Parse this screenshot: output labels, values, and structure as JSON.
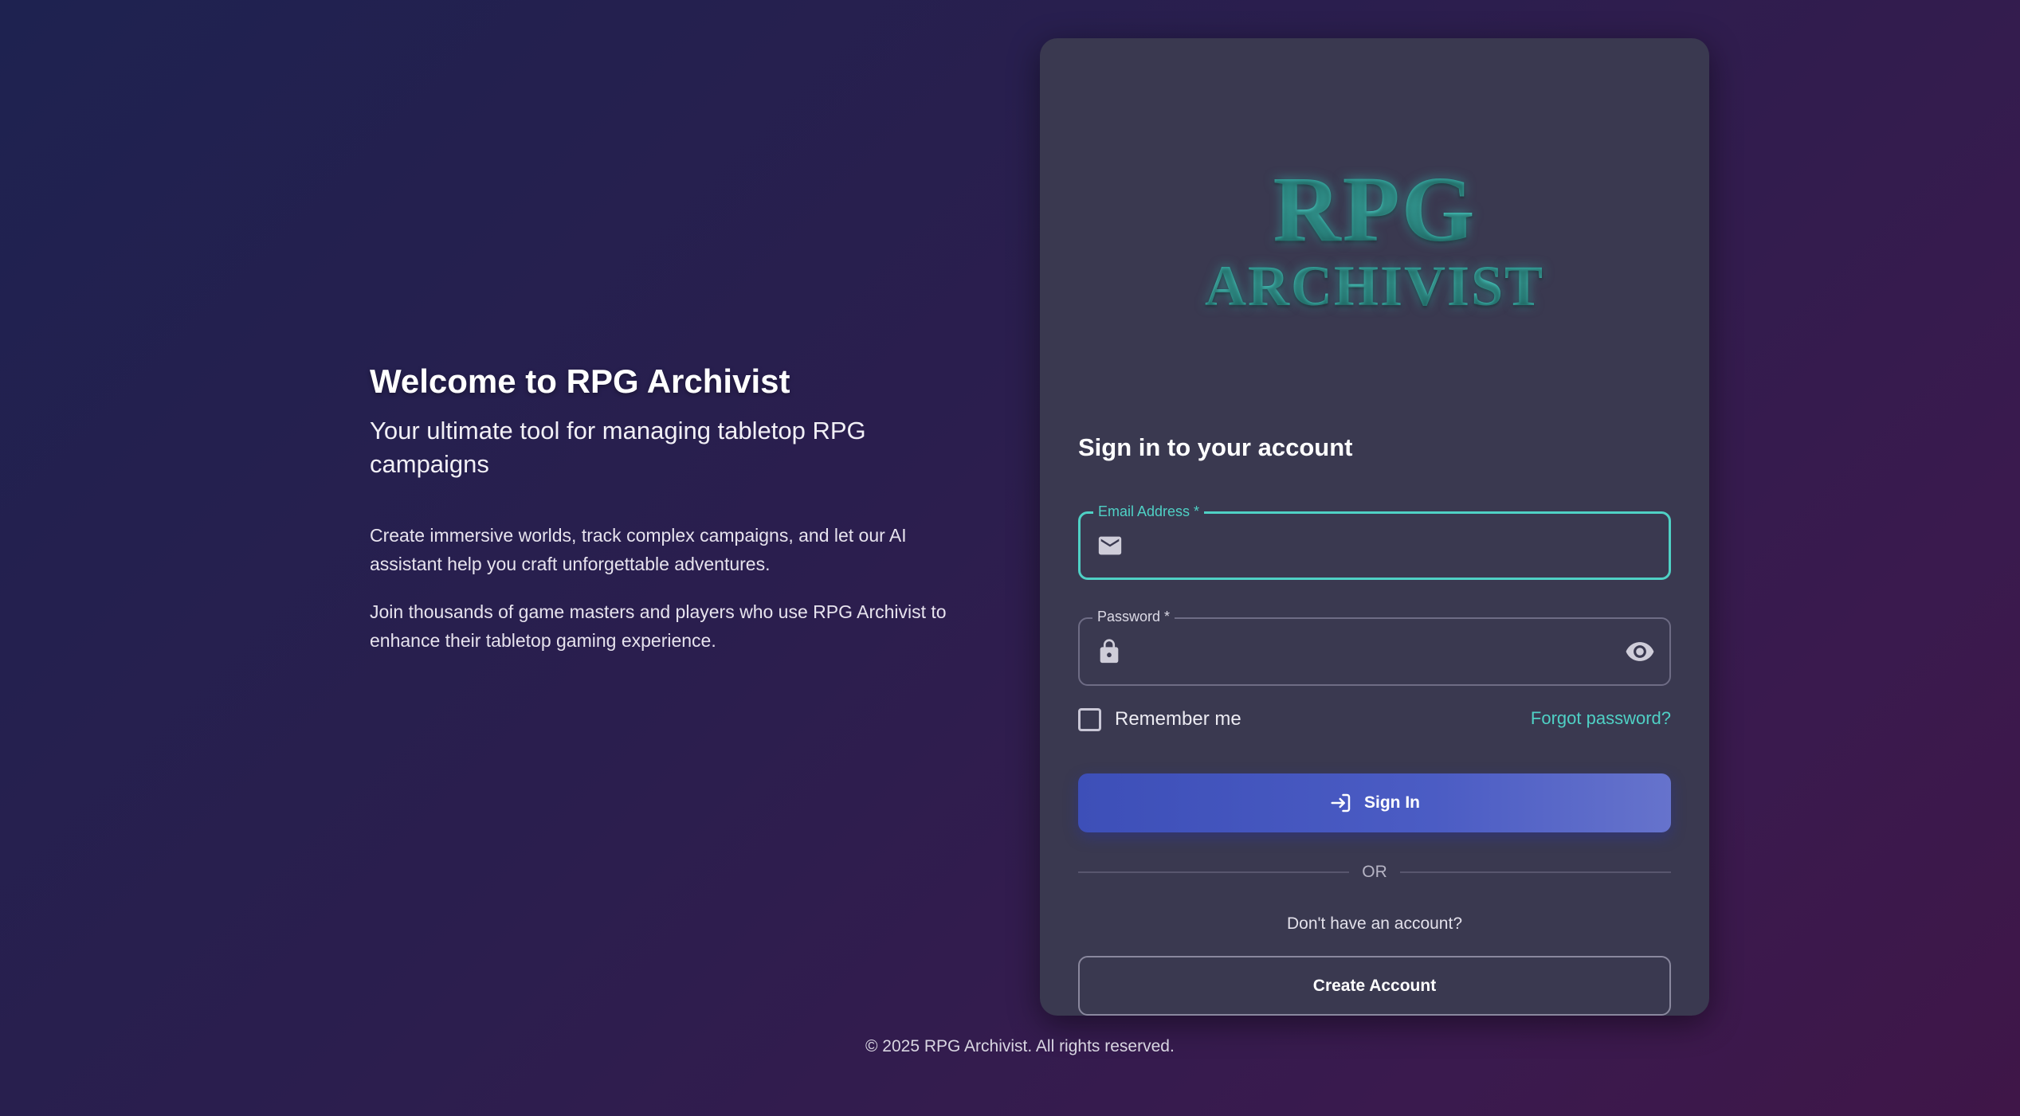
{
  "intro": {
    "title": "Welcome to RPG Archivist",
    "subtitle": "Your ultimate tool for managing tabletop RPG campaigns",
    "paragraph1": "Create immersive worlds, track complex campaigns, and let our AI assistant help you craft unforgettable adventures.",
    "paragraph2": "Join thousands of game masters and players who use RPG Archivist to enhance their tabletop gaming experience."
  },
  "logo": {
    "line1": "RPG",
    "line2": "ARCHIVIST"
  },
  "form": {
    "title": "Sign in to your account",
    "email": {
      "label": "Email Address *",
      "value": "",
      "icon": "mail-icon"
    },
    "password": {
      "label": "Password *",
      "value": "",
      "icon": "lock-icon",
      "toggle_icon": "eye-icon"
    },
    "remember_label": "Remember me",
    "remember_checked": false,
    "forgot_label": "Forgot password?",
    "signin_label": "Sign In",
    "signin_icon": "login-icon",
    "divider_label": "OR",
    "no_account_text": "Don't have an account?",
    "create_label": "Create Account"
  },
  "footer": {
    "text": "© 2025 RPG Archivist. All rights reserved."
  },
  "colors": {
    "accent": "#4fd1c5",
    "primary_button": "#3d4fb8",
    "card": "#3a3950"
  }
}
